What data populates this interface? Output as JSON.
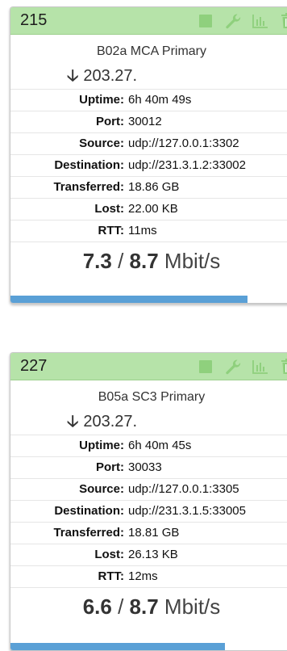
{
  "colors": {
    "header_bg": "#b6e3a9",
    "progress_bar": "#5aa0d6",
    "icon": "#8fd07d"
  },
  "streams": [
    {
      "id": "215",
      "icons": [
        "stop-icon",
        "wrench-icon",
        "stats-icon",
        "trash-icon"
      ],
      "name": "B02a MCA Primary",
      "direction_icon": "arrow-down-icon",
      "address": "203.27.",
      "fields": [
        {
          "label": "Uptime:",
          "value": "6h 40m 49s"
        },
        {
          "label": "Port:",
          "value": "30012"
        },
        {
          "label": "Source:",
          "value": "udp://127.0.0.1:3302"
        },
        {
          "label": "Destination:",
          "value": "udp://231.3.1.2:33002"
        },
        {
          "label": "Transferred:",
          "value": "18.86 GB"
        },
        {
          "label": "Lost:",
          "value": "22.00 KB"
        },
        {
          "label": "RTT:",
          "value": "11ms"
        }
      ],
      "rate_current": "7.3",
      "rate_sep": " / ",
      "rate_max": "8.7",
      "rate_unit": " Mbit/s",
      "progress_fraction": 0.84
    },
    {
      "id": "227",
      "icons": [
        "stop-icon",
        "wrench-icon",
        "stats-icon",
        "trash-icon"
      ],
      "name": "B05a SC3 Primary",
      "direction_icon": "arrow-down-icon",
      "address": "203.27.",
      "fields": [
        {
          "label": "Uptime:",
          "value": "6h 40m 45s"
        },
        {
          "label": "Port:",
          "value": "30033"
        },
        {
          "label": "Source:",
          "value": "udp://127.0.0.1:3305"
        },
        {
          "label": "Destination:",
          "value": "udp://231.3.1.5:33005"
        },
        {
          "label": "Transferred:",
          "value": "18.81 GB"
        },
        {
          "label": "Lost:",
          "value": "26.13 KB"
        },
        {
          "label": "RTT:",
          "value": "12ms"
        }
      ],
      "rate_current": "6.6",
      "rate_sep": " / ",
      "rate_max": "8.7",
      "rate_unit": " Mbit/s",
      "progress_fraction": 0.76
    }
  ]
}
